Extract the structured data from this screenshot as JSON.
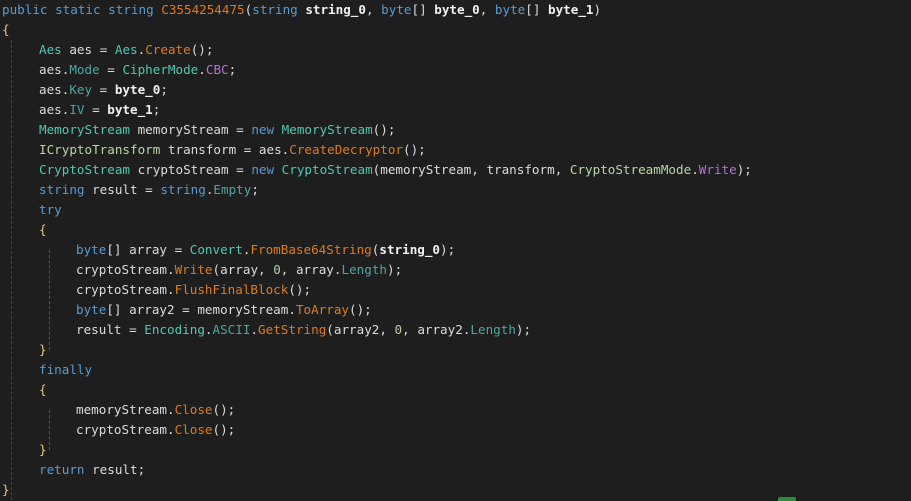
{
  "editor": {
    "language": "C#",
    "theme": "dark",
    "method_name": "C3554254475",
    "lines": [
      {
        "indent": 0,
        "tokens": [
          [
            "kw",
            "public "
          ],
          [
            "kw",
            "static "
          ],
          [
            "kw",
            "string "
          ],
          [
            "fn",
            "C3554254475"
          ],
          [
            "pn",
            "("
          ],
          [
            "kw",
            "string "
          ],
          [
            "bd",
            "string_0"
          ],
          [
            "pn",
            ", "
          ],
          [
            "kw",
            "byte"
          ],
          [
            "pn",
            "[] "
          ],
          [
            "bd",
            "byte_0"
          ],
          [
            "pn",
            ", "
          ],
          [
            "kw",
            "byte"
          ],
          [
            "pn",
            "[] "
          ],
          [
            "bd",
            "byte_1"
          ],
          [
            "pn",
            ")"
          ]
        ]
      },
      {
        "indent": 0,
        "tokens": [
          [
            "brace",
            "{"
          ]
        ]
      },
      {
        "indent": 1,
        "tokens": [
          [
            "ty",
            "Aes "
          ],
          [
            "id",
            "aes "
          ],
          [
            "pn",
            "= "
          ],
          [
            "ty",
            "Aes"
          ],
          [
            "pn",
            "."
          ],
          [
            "fn",
            "Create"
          ],
          [
            "pn",
            "();"
          ]
        ]
      },
      {
        "indent": 1,
        "tokens": [
          [
            "id",
            "aes"
          ],
          [
            "pn",
            "."
          ],
          [
            "pr",
            "Mode"
          ],
          [
            "pn",
            " = "
          ],
          [
            "ty",
            "CipherMode"
          ],
          [
            "pn",
            "."
          ],
          [
            "en",
            "CBC"
          ],
          [
            "pn",
            ";"
          ]
        ]
      },
      {
        "indent": 1,
        "tokens": [
          [
            "id",
            "aes"
          ],
          [
            "pn",
            "."
          ],
          [
            "pr",
            "Key"
          ],
          [
            "pn",
            " = "
          ],
          [
            "bd",
            "byte_0"
          ],
          [
            "pn",
            ";"
          ]
        ]
      },
      {
        "indent": 1,
        "tokens": [
          [
            "id",
            "aes"
          ],
          [
            "pn",
            "."
          ],
          [
            "pr",
            "IV"
          ],
          [
            "pn",
            " = "
          ],
          [
            "bd",
            "byte_1"
          ],
          [
            "pn",
            ";"
          ]
        ]
      },
      {
        "indent": 1,
        "tokens": [
          [
            "ty",
            "MemoryStream "
          ],
          [
            "id",
            "memoryStream "
          ],
          [
            "pn",
            "= "
          ],
          [
            "kw",
            "new "
          ],
          [
            "ty",
            "MemoryStream"
          ],
          [
            "pn",
            "();"
          ]
        ]
      },
      {
        "indent": 1,
        "tokens": [
          [
            "iface",
            "ICryptoTransform "
          ],
          [
            "id",
            "transform "
          ],
          [
            "pn",
            "= "
          ],
          [
            "id",
            "aes"
          ],
          [
            "pn",
            "."
          ],
          [
            "fn",
            "CreateDecryptor"
          ],
          [
            "pn",
            "();"
          ]
        ]
      },
      {
        "indent": 1,
        "tokens": [
          [
            "ty",
            "CryptoStream "
          ],
          [
            "id",
            "cryptoStream "
          ],
          [
            "pn",
            "= "
          ],
          [
            "kw",
            "new "
          ],
          [
            "ty",
            "CryptoStream"
          ],
          [
            "pn",
            "("
          ],
          [
            "id",
            "memoryStream"
          ],
          [
            "pn",
            ", "
          ],
          [
            "id",
            "transform"
          ],
          [
            "pn",
            ", "
          ],
          [
            "ic",
            "CryptoStreamMode"
          ],
          [
            "pn",
            "."
          ],
          [
            "en",
            "Write"
          ],
          [
            "pn",
            ");"
          ]
        ]
      },
      {
        "indent": 1,
        "tokens": [
          [
            "kw",
            "string "
          ],
          [
            "id",
            "result "
          ],
          [
            "pn",
            "= "
          ],
          [
            "kw",
            "string"
          ],
          [
            "pn",
            "."
          ],
          [
            "pr",
            "Empty"
          ],
          [
            "pn",
            ";"
          ]
        ]
      },
      {
        "indent": 1,
        "tokens": [
          [
            "kw",
            "try"
          ]
        ]
      },
      {
        "indent": 1,
        "tokens": [
          [
            "brace",
            "{"
          ]
        ]
      },
      {
        "indent": 2,
        "tokens": [
          [
            "kw",
            "byte"
          ],
          [
            "pn",
            "[] "
          ],
          [
            "id",
            "array "
          ],
          [
            "pn",
            "= "
          ],
          [
            "ty",
            "Convert"
          ],
          [
            "pn",
            "."
          ],
          [
            "fn",
            "FromBase64String"
          ],
          [
            "pn",
            "("
          ],
          [
            "bd",
            "string_0"
          ],
          [
            "pn",
            ");"
          ]
        ]
      },
      {
        "indent": 2,
        "tokens": [
          [
            "id",
            "cryptoStream"
          ],
          [
            "pn",
            "."
          ],
          [
            "fn",
            "Write"
          ],
          [
            "pn",
            "("
          ],
          [
            "id",
            "array"
          ],
          [
            "pn",
            ", "
          ],
          [
            "num",
            "0"
          ],
          [
            "pn",
            ", "
          ],
          [
            "id",
            "array"
          ],
          [
            "pn",
            "."
          ],
          [
            "pr",
            "Length"
          ],
          [
            "pn",
            ");"
          ]
        ]
      },
      {
        "indent": 2,
        "tokens": [
          [
            "id",
            "cryptoStream"
          ],
          [
            "pn",
            "."
          ],
          [
            "fn",
            "FlushFinalBlock"
          ],
          [
            "pn",
            "();"
          ]
        ]
      },
      {
        "indent": 2,
        "tokens": [
          [
            "kw",
            "byte"
          ],
          [
            "pn",
            "[] "
          ],
          [
            "id",
            "array2 "
          ],
          [
            "pn",
            "= "
          ],
          [
            "id",
            "memoryStream"
          ],
          [
            "pn",
            "."
          ],
          [
            "fn",
            "ToArray"
          ],
          [
            "pn",
            "();"
          ]
        ]
      },
      {
        "indent": 2,
        "tokens": [
          [
            "id",
            "result "
          ],
          [
            "pn",
            "= "
          ],
          [
            "ty",
            "Encoding"
          ],
          [
            "pn",
            "."
          ],
          [
            "pr",
            "ASCII"
          ],
          [
            "pn",
            "."
          ],
          [
            "fn",
            "GetString"
          ],
          [
            "pn",
            "("
          ],
          [
            "id",
            "array2"
          ],
          [
            "pn",
            ", "
          ],
          [
            "num",
            "0"
          ],
          [
            "pn",
            ", "
          ],
          [
            "id",
            "array2"
          ],
          [
            "pn",
            "."
          ],
          [
            "pr",
            "Length"
          ],
          [
            "pn",
            ");"
          ]
        ]
      },
      {
        "indent": 1,
        "tokens": [
          [
            "brace",
            "}"
          ]
        ]
      },
      {
        "indent": 1,
        "tokens": [
          [
            "kw",
            "finally"
          ]
        ]
      },
      {
        "indent": 1,
        "tokens": [
          [
            "brace",
            "{"
          ]
        ]
      },
      {
        "indent": 2,
        "tokens": [
          [
            "id",
            "memoryStream"
          ],
          [
            "pn",
            "."
          ],
          [
            "fn",
            "Close"
          ],
          [
            "pn",
            "();"
          ]
        ]
      },
      {
        "indent": 2,
        "tokens": [
          [
            "id",
            "cryptoStream"
          ],
          [
            "pn",
            "."
          ],
          [
            "fn",
            "Close"
          ],
          [
            "pn",
            "();"
          ]
        ]
      },
      {
        "indent": 1,
        "tokens": [
          [
            "brace",
            "}"
          ]
        ]
      },
      {
        "indent": 1,
        "tokens": [
          [
            "kw",
            "return "
          ],
          [
            "id",
            "result"
          ],
          [
            "pn",
            ";"
          ]
        ]
      },
      {
        "indent": 0,
        "tokens": [
          [
            "brace",
            "}"
          ]
        ]
      }
    ]
  },
  "colors": {
    "background": "#1e1e1e",
    "keyword": "#569cd6",
    "type": "#4ec9b0",
    "method": "#e07a1f",
    "property": "#4aa7a0",
    "enum_member": "#b76fd8",
    "status_marker": "#2d8a3a"
  }
}
